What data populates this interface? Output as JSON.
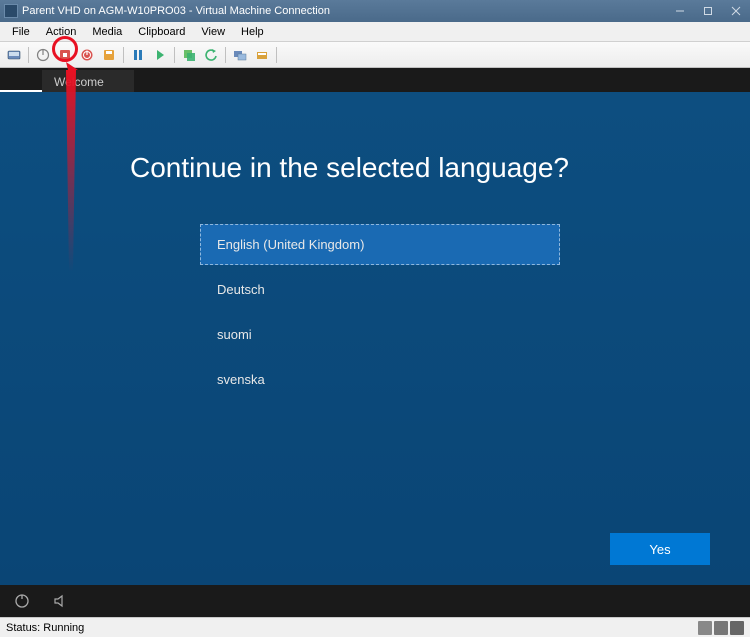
{
  "window": {
    "title": "Parent VHD on AGM-W10PRO03 - Virtual Machine Connection"
  },
  "menu": {
    "file": "File",
    "action": "Action",
    "media": "Media",
    "clipboard": "Clipboard",
    "view": "View",
    "help": "Help"
  },
  "tab": {
    "label": "Welcome"
  },
  "content": {
    "heading": "Continue in the selected language?",
    "options": [
      {
        "label": "English (United Kingdom)",
        "selected": true
      },
      {
        "label": "Deutsch",
        "selected": false
      },
      {
        "label": "suomi",
        "selected": false
      },
      {
        "label": "svenska",
        "selected": false
      }
    ],
    "yes_label": "Yes"
  },
  "status": {
    "text": "Status: Running"
  },
  "colors": {
    "accent": "#0078d4",
    "vm_bg": "#0a4a7a",
    "highlight_red": "#e81123"
  }
}
